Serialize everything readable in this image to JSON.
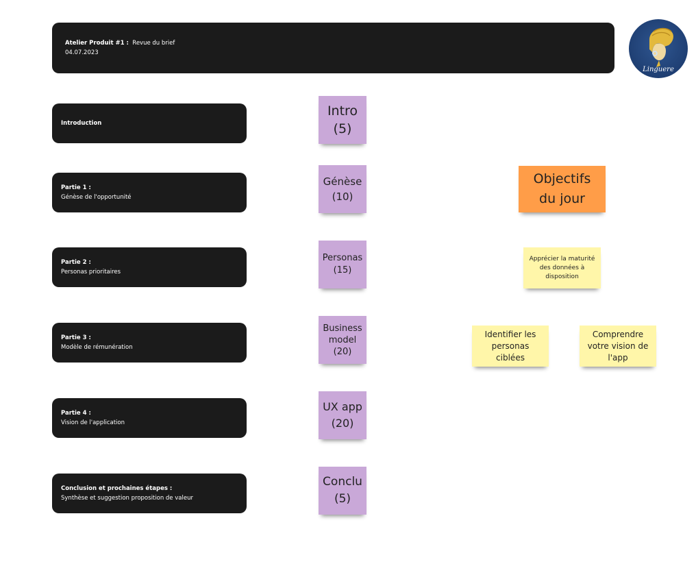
{
  "header": {
    "title_bold": "Atelier Produit #1 :",
    "title_rest": "Revue du brief",
    "date": "04.07.2023"
  },
  "logo": {
    "text": "Linguere",
    "icon": "woman-headwrap-logo"
  },
  "sections": [
    {
      "title": "Introduction",
      "subtitle": ""
    },
    {
      "title": "Partie 1 :",
      "subtitle": "Génèse de l'opportunité"
    },
    {
      "title": "Partie 2 :",
      "subtitle": "Personas prioritaires"
    },
    {
      "title": "Partie 3 :",
      "subtitle": "Modèle de rémunération"
    },
    {
      "title": "Partie 4 :",
      "subtitle": "Vision de l'application"
    },
    {
      "title": "Conclusion et prochaines étapes :",
      "subtitle": "Synthèse et suggestion proposition de valeur"
    }
  ],
  "agenda_notes": [
    {
      "label": "Intro",
      "minutes": "(5)"
    },
    {
      "label": "Génèse",
      "minutes": "(10)"
    },
    {
      "label": "Personas",
      "minutes": "(15)"
    },
    {
      "label": "Business model",
      "minutes": "(20)"
    },
    {
      "label": "UX app",
      "minutes": "(20)"
    },
    {
      "label": "Conclu",
      "minutes": "(5)"
    }
  ],
  "objectives": {
    "title": "Objectifs du jour",
    "items": [
      "Apprécier la maturité des données à disposition",
      "Identifier les personas ciblées",
      "Comprendre votre vision de l'app"
    ]
  },
  "colors": {
    "card": "#1b1b1b",
    "purple_note": "#c9a8d8",
    "orange_note": "#ff9d48",
    "yellow_note": "#fff6a9",
    "logo_blue": "#1f3f73",
    "logo_gold": "#e3b93c"
  }
}
